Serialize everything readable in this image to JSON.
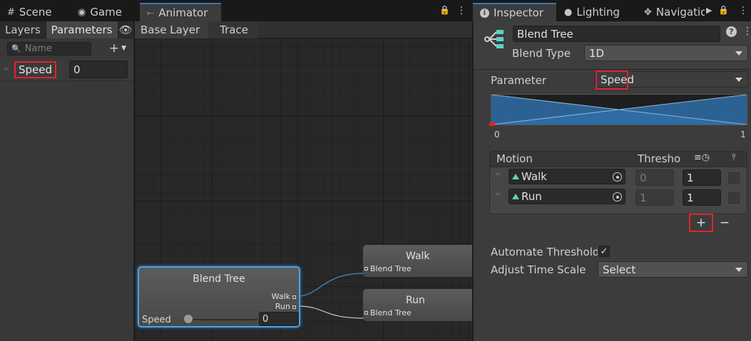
{
  "tabs_left": {
    "scene": "Scene",
    "game": "Game",
    "animator": "Animator"
  },
  "tabs_right": {
    "inspector": "Inspector",
    "lighting": "Lighting",
    "navigation": "Navigatio"
  },
  "params_panel": {
    "tab_layers": "Layers",
    "tab_parameters": "Parameters",
    "search_placeholder": "Name",
    "param_name": "Speed",
    "param_value": "0"
  },
  "breadcrumb": [
    "Base Layer",
    "Trace"
  ],
  "graph": {
    "blend_tree_title": "Blend Tree",
    "port_walk": "Walk",
    "port_run": "Run",
    "speed_label": "Speed",
    "speed_value": "0",
    "walk_node_title": "Walk",
    "run_node_title": "Run",
    "inport_label": "Blend Tree"
  },
  "inspector": {
    "name": "Blend Tree",
    "blend_type_label": "Blend Type",
    "blend_type_value": "1D",
    "parameter_label": "Parameter",
    "parameter_value": "Speed",
    "range_min": "0",
    "range_max": "1",
    "motion_header": "Motion",
    "threshold_header": "Thresho",
    "motions": [
      {
        "name": "Walk",
        "threshold": "0",
        "speed": "1"
      },
      {
        "name": "Run",
        "threshold": "1",
        "speed": "1"
      }
    ],
    "add_label": "+",
    "remove_label": "−",
    "automate_label": "Automate Thresholds",
    "automate_check": "✓",
    "adjust_label": "Adjust Time Scale",
    "adjust_value": "Select"
  },
  "icons": {
    "grid": "#",
    "gamepad": "◉",
    "animator": "⤚",
    "info": "i",
    "bulb": "●",
    "nav": "✥",
    "lock": "🔒",
    "more": "⋮",
    "eye": "👁",
    "search": "🔍",
    "plus": "+",
    "play": "▶"
  },
  "colors": {
    "accent": "#3a79bb",
    "highlight": "#e2232c",
    "selection": "#4aa1e6",
    "motion_icon": "#5fd0c4"
  }
}
